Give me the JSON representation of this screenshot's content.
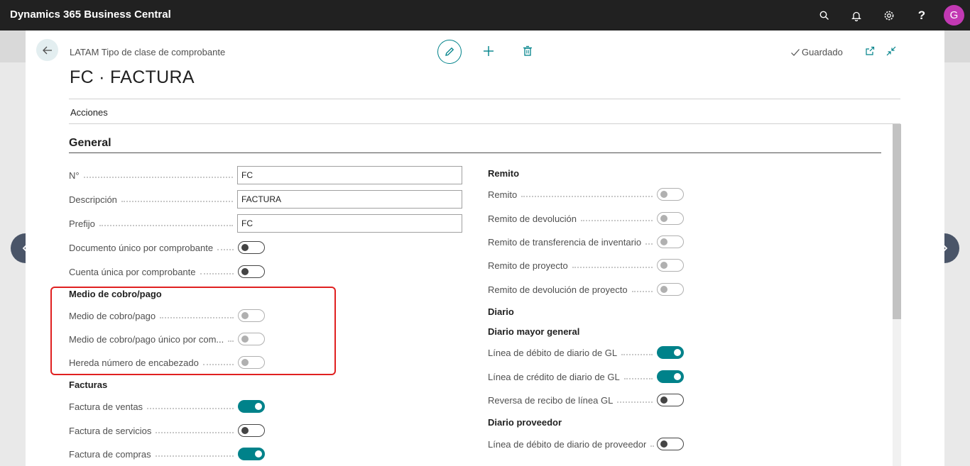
{
  "app": {
    "title": "Dynamics 365 Business Central",
    "avatar_letter": "G"
  },
  "header": {
    "breadcrumb": "LATAM Tipo de clase de comprobante",
    "title": "FC · FACTURA",
    "saved_label": "Guardado",
    "actions_label": "Acciones"
  },
  "section": {
    "title": "General"
  },
  "left": {
    "no_label": "N°",
    "no_value": "FC",
    "desc_label": "Descripción",
    "desc_value": "FACTURA",
    "prefijo_label": "Prefijo",
    "prefijo_value": "FC",
    "doc_unico_label": "Documento único por comprobante",
    "cuenta_unica_label": "Cuenta única por comprobante",
    "medio_group": "Medio de cobro/pago",
    "medio_label": "Medio de cobro/pago",
    "medio_unico_label": "Medio de cobro/pago único por com...",
    "hereda_label": "Hereda número de encabezado",
    "facturas_group": "Facturas",
    "fact_ventas_label": "Factura de ventas",
    "fact_servicios_label": "Factura de servicios",
    "fact_compras_label": "Factura de compras"
  },
  "right": {
    "remito_group": "Remito",
    "remito_label": "Remito",
    "remito_dev_label": "Remito de devolución",
    "remito_trans_label": "Remito de transferencia de inventario",
    "remito_proy_label": "Remito de proyecto",
    "remito_dev_proy_label": "Remito de devolución de proyecto",
    "diario_group": "Diario",
    "diario_mayor_group": "Diario mayor general",
    "linea_debito_gl_label": "Línea de débito de diario de GL",
    "linea_credito_gl_label": "Línea de crédito de diario de GL",
    "reversa_gl_label": "Reversa de recibo de línea GL",
    "diario_prov_group": "Diario proveedor",
    "linea_debito_prov_label": "Línea de débito de diario de proveedor"
  },
  "colors": {
    "accent": "#00828a",
    "highlight": "#e02020",
    "topbar": "#212121"
  }
}
